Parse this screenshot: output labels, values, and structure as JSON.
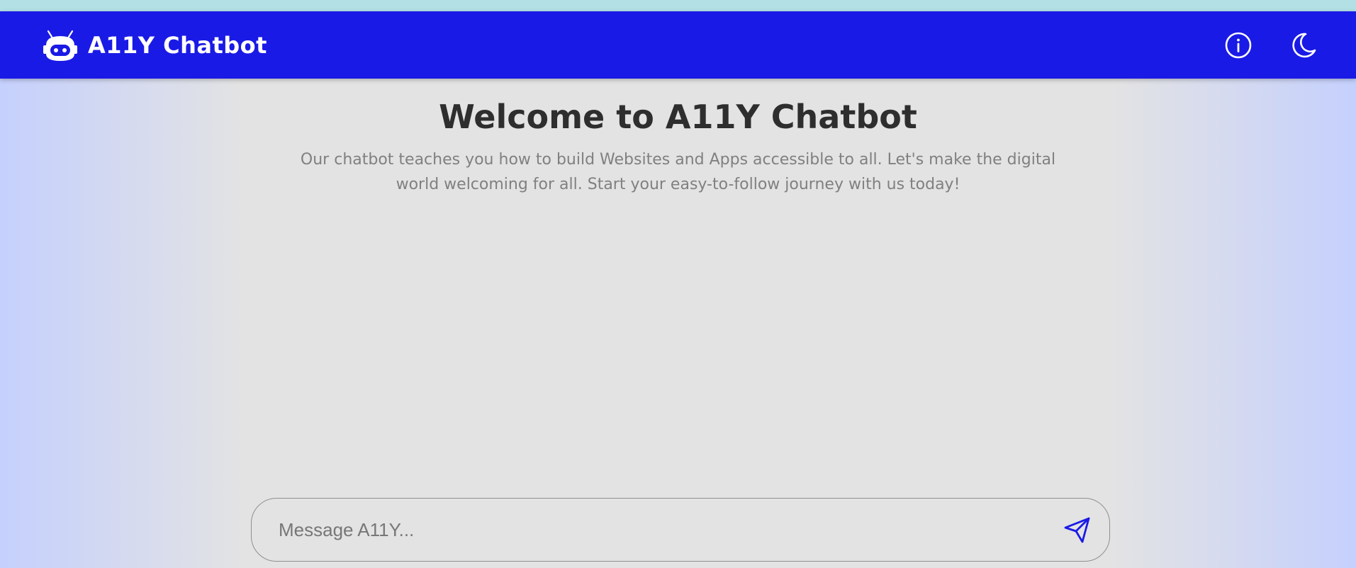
{
  "app": {
    "name": "A11Y Chatbot",
    "logo_icon": "robot-icon"
  },
  "header": {
    "info_icon": "info-icon",
    "theme_icon": "moon-icon"
  },
  "hero": {
    "title": "Welcome to A11Y Chatbot",
    "subtitle": "Our chatbot teaches you how to build Websites and Apps accessible to all. Let's make the digital world welcoming for all. Start your easy-to-follow journey with us today!"
  },
  "composer": {
    "placeholder": "Message A11Y...",
    "value": "",
    "send_icon": "send-icon"
  },
  "colors": {
    "brand": "#1a1ae6",
    "top_strip": "#b2e0e4",
    "background": "#e3e3e3",
    "side_gradient": "#c5d0fd",
    "title": "#2e2e2e",
    "subtitle": "#808080"
  }
}
